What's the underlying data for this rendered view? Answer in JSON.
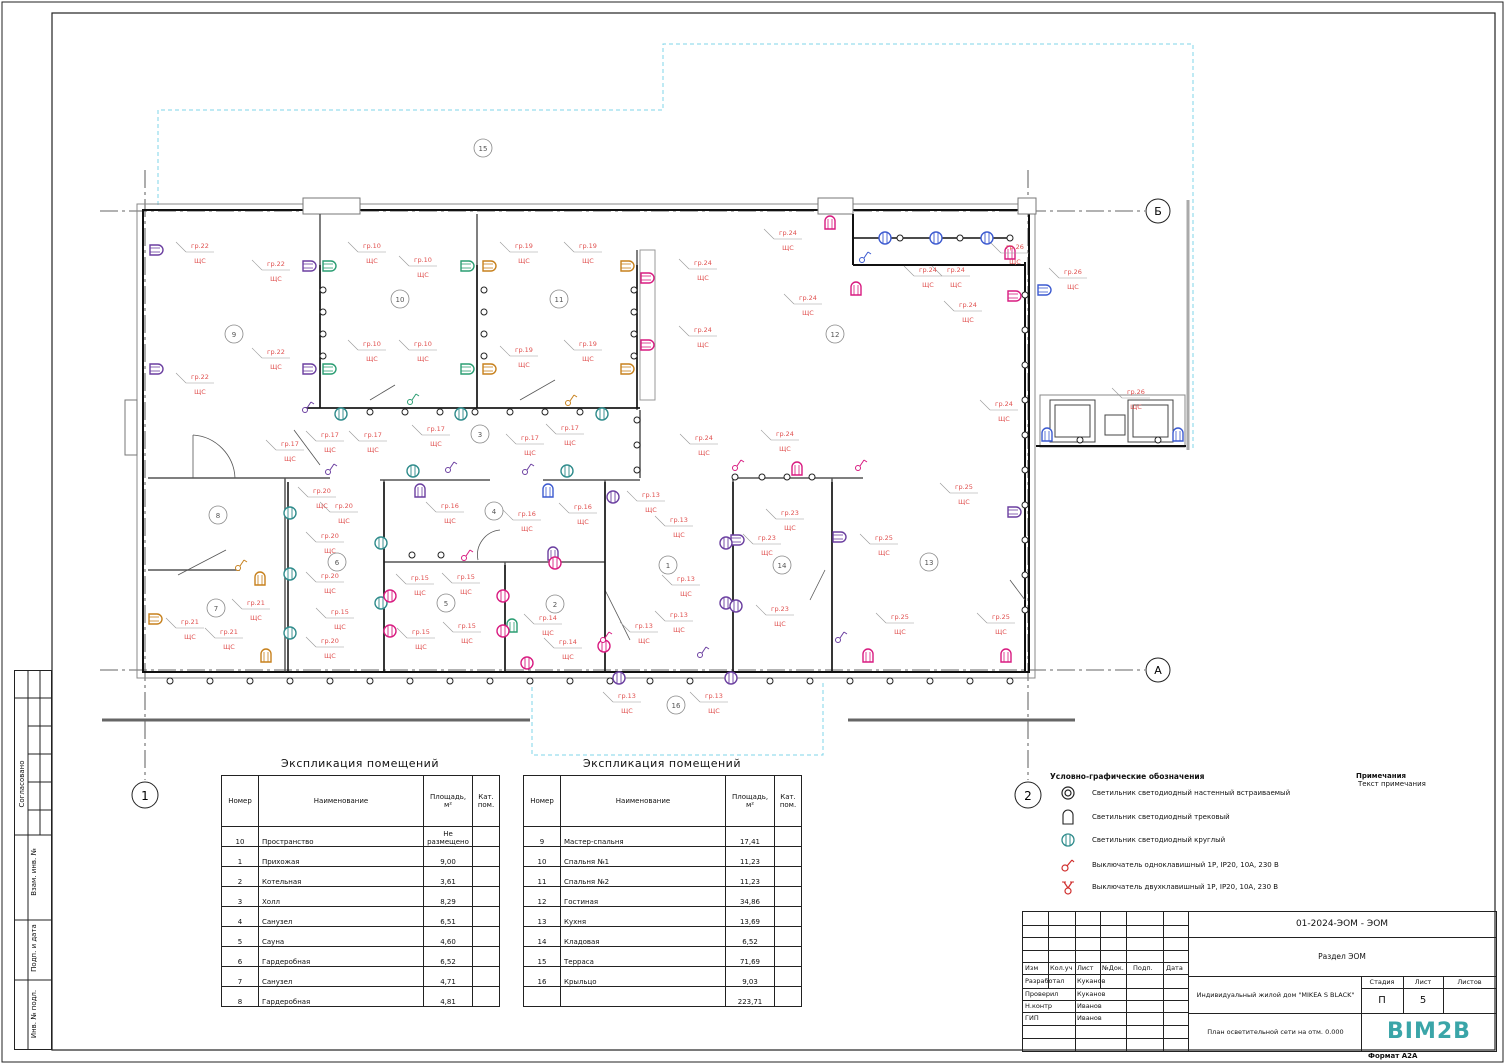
{
  "plan": {
    "axes": {
      "row_b": "Б",
      "row_a": "А",
      "col_1": "1",
      "col_2": "2"
    },
    "room_numbers": [
      "15",
      "9",
      "10",
      "11",
      "12",
      "3",
      "4",
      "8",
      "1",
      "14",
      "13",
      "6",
      "5",
      "2",
      "7",
      "16"
    ],
    "fixture_labels": [
      "гр.22",
      "гр.22",
      "гр.22",
      "гр.22",
      "гр.10",
      "гр.10",
      "гр.10",
      "гр.10",
      "гр.19",
      "гр.19",
      "гр.19",
      "гр.19",
      "гр.24",
      "гр.24",
      "гр.24",
      "гр.24",
      "гр.24",
      "гр.24",
      "гр.24",
      "гр.24",
      "гр.24",
      "гр.24",
      "гр.26",
      "гр.26",
      "гр.26",
      "гр.17",
      "гр.17",
      "гр.17",
      "гр.17",
      "гр.17",
      "гр.17",
      "гр.20",
      "гр.20",
      "гр.20",
      "гр.20",
      "гр.20",
      "гр.16",
      "гр.16",
      "гр.16",
      "гр.13",
      "гр.13",
      "гр.13",
      "гр.13",
      "гр.13",
      "гр.13",
      "гр.13",
      "гр.15",
      "гр.15",
      "гр.15",
      "гр.15",
      "гр.15",
      "гр.14",
      "гр.14",
      "гр.21",
      "гр.21",
      "гр.21",
      "гр.23",
      "гр.23",
      "гр.23",
      "гр.25",
      "гр.25",
      "гр.25",
      "гр.25"
    ],
    "panel_label": "ЩС"
  },
  "explication_left": {
    "title": "Экспликация помещений",
    "headers": {
      "num": "Номер",
      "name": "Наименование",
      "area": "Площадь, м²",
      "cat": "Кат. пом."
    },
    "rows": [
      {
        "num": "10",
        "name": "Пространство",
        "area": "Не размещено"
      },
      {
        "num": "1",
        "name": "Прихожая",
        "area": "9,00"
      },
      {
        "num": "2",
        "name": "Котельная",
        "area": "3,61"
      },
      {
        "num": "3",
        "name": "Холл",
        "area": "8,29"
      },
      {
        "num": "4",
        "name": "Санузел",
        "area": "6,51"
      },
      {
        "num": "5",
        "name": "Сауна",
        "area": "4,60"
      },
      {
        "num": "6",
        "name": "Гардеробная",
        "area": "6,52"
      },
      {
        "num": "7",
        "name": "Санузел",
        "area": "4,71"
      },
      {
        "num": "8",
        "name": "Гардеробная",
        "area": "4,81"
      }
    ]
  },
  "explication_right": {
    "title": "Экспликация помещений",
    "headers": {
      "num": "Номер",
      "name": "Наименование",
      "area": "Площадь, м²",
      "cat": "Кат. пом."
    },
    "rows": [
      {
        "num": "9",
        "name": "Мастер-спальня",
        "area": "17,41"
      },
      {
        "num": "10",
        "name": "Спальня №1",
        "area": "11,23"
      },
      {
        "num": "11",
        "name": "Спальня №2",
        "area": "11,23"
      },
      {
        "num": "12",
        "name": "Гостиная",
        "area": "34,86"
      },
      {
        "num": "13",
        "name": "Кухня",
        "area": "13,69"
      },
      {
        "num": "14",
        "name": "Кладовая",
        "area": "6,52"
      },
      {
        "num": "15",
        "name": "Терраса",
        "area": "71,69"
      },
      {
        "num": "16",
        "name": "Крыльцо",
        "area": "9,03"
      },
      {
        "num": "",
        "name": "",
        "area": "223,71"
      }
    ]
  },
  "legend": {
    "title": "Условно-графические обозначения",
    "items": [
      {
        "icon": "recessed-wall-light-icon",
        "text": "Светильник светодиодный настенный встраиваемый"
      },
      {
        "icon": "track-light-icon",
        "text": "Светильник светодиодный трековый"
      },
      {
        "icon": "round-light-icon",
        "text": "Светильник светодиодный круглый"
      },
      {
        "icon": "single-switch-icon",
        "text": "Выключатель одноклавишный 1P, IP20, 10А, 230 В"
      },
      {
        "icon": "double-switch-icon",
        "text": "Выключатель двухклавишный 1P, IP20, 10А, 230 В"
      }
    ]
  },
  "notes": {
    "title": "Примечания",
    "text": "Текст примечания"
  },
  "title_block": {
    "code": "01-2024-ЭОМ - ЭОМ",
    "section": "Раздел ЭОМ",
    "project": "Индивидуальный жилой дом \"MIKEA S BLACK\"",
    "sheet_title": "План осветительной сети на отм. 0.000",
    "col_headers": {
      "izm": "Изм",
      "kol": "Кол.уч",
      "list": "Лист",
      "ndok": "№Док.",
      "podp": "Подп.",
      "data": "Дата"
    },
    "roles": [
      {
        "role": "Разработал",
        "name": "Куканов"
      },
      {
        "role": "Проверил",
        "name": "Куканов"
      },
      {
        "role": "Н.контр",
        "name": "Иванов"
      },
      {
        "role": "ГИП",
        "name": "Иванов"
      }
    ],
    "stage_header": "Стадия",
    "sheet_header": "Лист",
    "sheets_header": "Листов",
    "stage": "П",
    "sheet_no": "5",
    "sheets": "",
    "logo": "BIM2B",
    "format": "Формат А2А"
  },
  "side_stamp": {
    "agreed": "Согласовано",
    "inv_vzam": "Взам. инв. №",
    "podp_data": "Подп. и дата",
    "inv_podl": "Инв. № подл."
  },
  "colors": {
    "red_text": "#e0504f",
    "cyan_dash": "#7fd6ea",
    "purple": "#6b3fa0",
    "green": "#2a9d72",
    "orange": "#c7811d",
    "magenta": "#d81b80",
    "blue": "#3c5ad0",
    "teal": "#2e8b8b",
    "wall": "#888888"
  }
}
